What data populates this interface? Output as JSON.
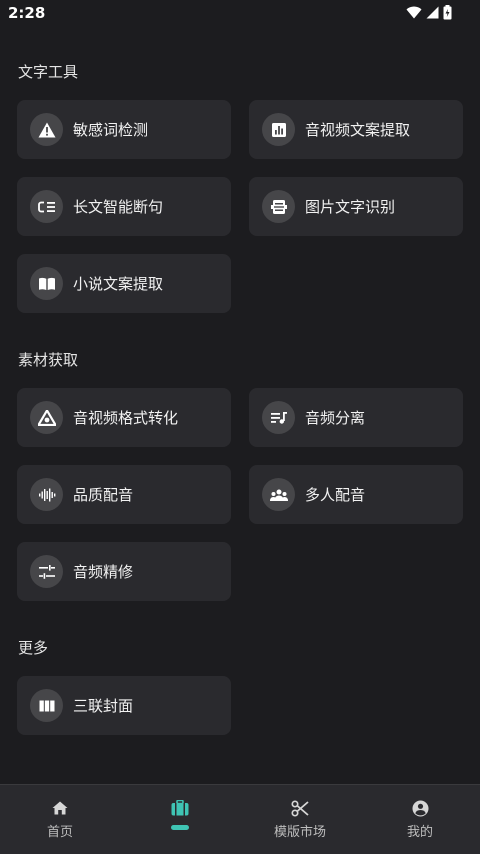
{
  "status": {
    "time": "2:28"
  },
  "sections": {
    "text_tools": {
      "title": "文字工具",
      "items": [
        "敏感词检测",
        "音视频文案提取",
        "长文智能断句",
        "图片文字识别",
        "小说文案提取"
      ]
    },
    "materials": {
      "title": "素材获取",
      "items": [
        "音视频格式转化",
        "音频分离",
        "品质配音",
        "多人配音",
        "音频精修"
      ]
    },
    "more": {
      "title": "更多",
      "items": [
        "三联封面"
      ]
    }
  },
  "tabs": [
    {
      "label": "首页",
      "icon": "home-icon"
    },
    {
      "label": "",
      "icon": "toolbox-icon",
      "active": true
    },
    {
      "label": "模版市场",
      "icon": "scissors-icon"
    },
    {
      "label": "我的",
      "icon": "account-icon"
    }
  ],
  "colors": {
    "accent": "#3fc4b4",
    "card": "#2a2a2e",
    "background": "#1c1c1f"
  }
}
